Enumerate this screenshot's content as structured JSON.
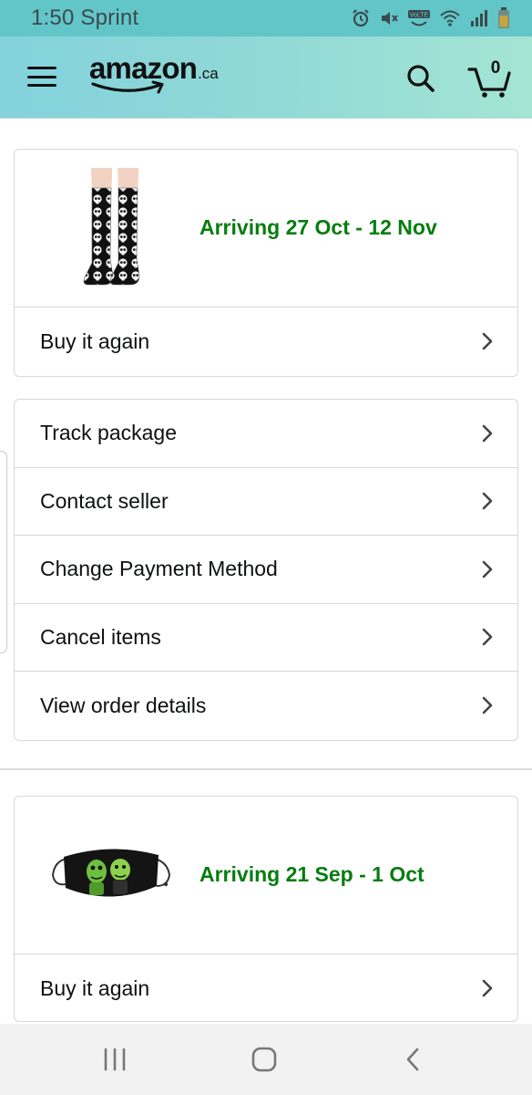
{
  "status_bar": {
    "time": "1:50",
    "carrier": "Sprint",
    "icons": [
      "alarm-icon",
      "mute-icon",
      "volte-icon",
      "wifi-icon",
      "signal-icon",
      "battery-icon"
    ],
    "volte_label": "VoLTE"
  },
  "header": {
    "logo_text": "amazon",
    "logo_suffix": ".ca",
    "cart_count": "0",
    "accent_color": "#83d2dc"
  },
  "orders": [
    {
      "arrival": "Arriving 27 Oct - 12 Nov",
      "product_image": "skull-print-knee-socks",
      "buy_again_label": "Buy it again"
    },
    {
      "arrival": "Arriving 21 Sep - 1 Oct",
      "product_image": "character-face-mask",
      "buy_again_label": "Buy it again"
    }
  ],
  "actions": [
    {
      "label": "Track package"
    },
    {
      "label": "Contact seller"
    },
    {
      "label": "Change Payment Method"
    },
    {
      "label": "Cancel items"
    },
    {
      "label": "View order details"
    }
  ],
  "colors": {
    "arrival_green": "#067d0f",
    "border": "#d5d9d9"
  },
  "nav_bar": {
    "buttons": [
      "recent-apps-icon",
      "home-icon",
      "back-icon"
    ]
  }
}
